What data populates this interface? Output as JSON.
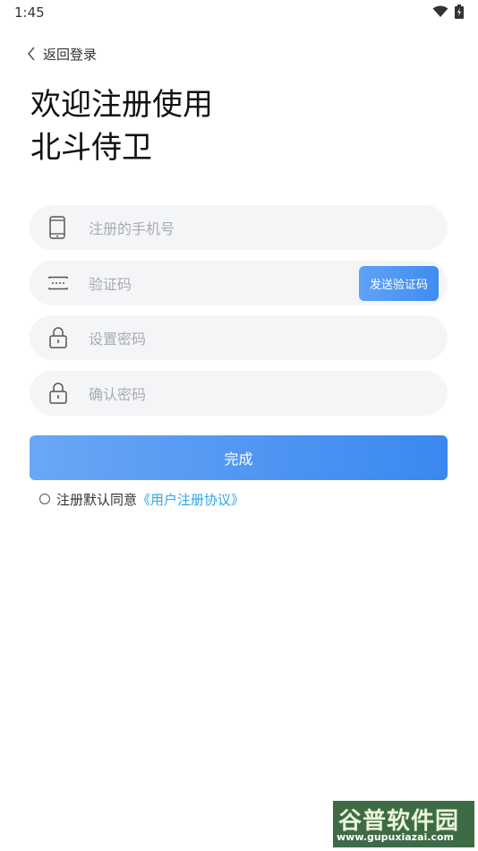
{
  "status_bar": {
    "time": "1:45"
  },
  "header": {
    "back_label": "返回登录"
  },
  "title": {
    "line1": "欢迎注册使用",
    "line2": "北斗侍卫"
  },
  "form": {
    "phone_placeholder": "注册的手机号",
    "code_placeholder": "验证码",
    "send_code_label": "发送验证码",
    "password_placeholder": "设置密码",
    "confirm_placeholder": "确认密码",
    "submit_label": "完成"
  },
  "agreement": {
    "text": "注册默认同意",
    "link": "《用户注册协议》"
  },
  "watermark": {
    "brand": "谷普软件园",
    "url": "www.gupuxiazai.com"
  },
  "colors": {
    "accent": "#3f8cf1",
    "link": "#2aa7e8",
    "field_bg": "#f4f5f7"
  }
}
